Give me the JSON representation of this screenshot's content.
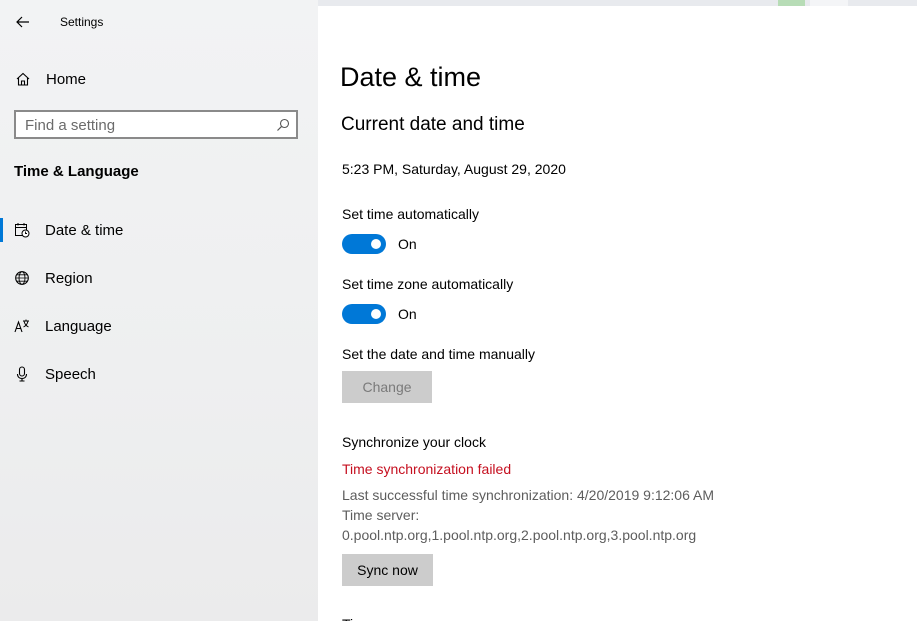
{
  "window": {
    "title": "Settings"
  },
  "sidebar": {
    "home_label": "Home",
    "search_placeholder": "Find a setting",
    "section_title": "Time & Language",
    "items": [
      {
        "label": "Date & time",
        "icon": "calendar-clock-icon",
        "selected": true
      },
      {
        "label": "Region",
        "icon": "globe-icon",
        "selected": false
      },
      {
        "label": "Language",
        "icon": "language-icon",
        "selected": false
      },
      {
        "label": "Speech",
        "icon": "microphone-icon",
        "selected": false
      }
    ]
  },
  "main": {
    "page_title": "Date & time",
    "current_heading": "Current date and time",
    "current_datetime": "5:23 PM, Saturday, August 29, 2020",
    "set_time_auto": {
      "label": "Set time automatically",
      "state": "On"
    },
    "set_zone_auto": {
      "label": "Set time zone automatically",
      "state": "On"
    },
    "manual": {
      "label": "Set the date and time manually",
      "button": "Change"
    },
    "sync": {
      "heading": "Synchronize your clock",
      "error": "Time synchronization failed",
      "last_success": "Last successful time synchronization: 4/20/2019 9:12:06 AM",
      "server_label": "Time server:",
      "server_value": "0.pool.ntp.org,1.pool.ntp.org,2.pool.ntp.org,3.pool.ntp.org",
      "button": "Sync now"
    },
    "next_heading_partial": "Ti"
  },
  "colors": {
    "accent": "#0078d7",
    "error": "#c50f1f",
    "sidebar_bg": "#f2f3f4",
    "button_bg": "#cccccc"
  }
}
